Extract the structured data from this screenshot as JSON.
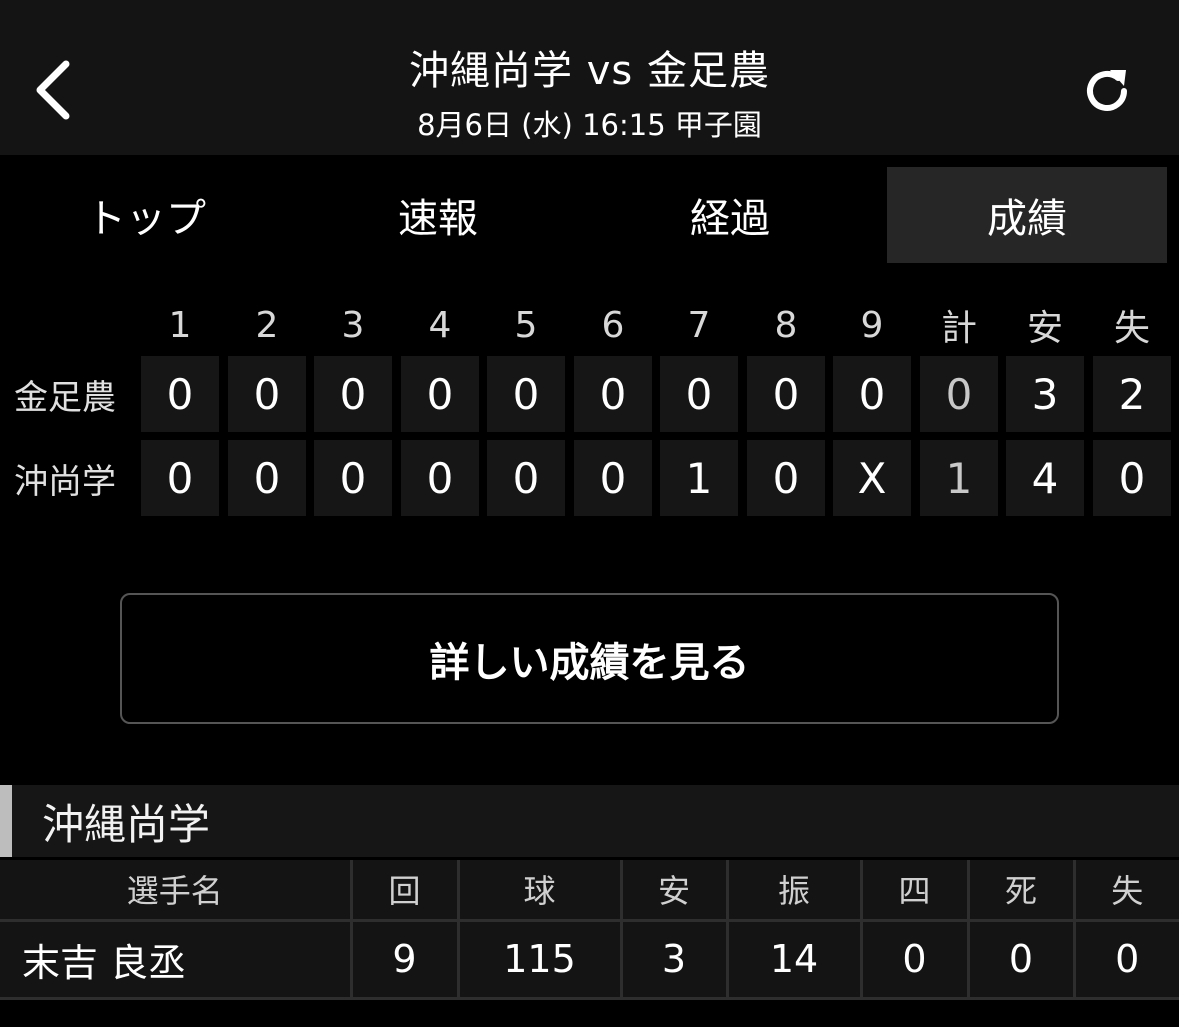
{
  "header": {
    "title": "沖縄尚学 vs 金足農",
    "subtitle": "8月6日 (水) 16:15 甲子園"
  },
  "tabs": [
    {
      "label": "トップ",
      "active": false
    },
    {
      "label": "速報",
      "active": false
    },
    {
      "label": "経過",
      "active": false
    },
    {
      "label": "成績",
      "active": true
    }
  ],
  "scoreboard": {
    "columns": [
      "1",
      "2",
      "3",
      "4",
      "5",
      "6",
      "7",
      "8",
      "9",
      "計",
      "安",
      "失"
    ],
    "teams": [
      {
        "name": "金足農",
        "scores": [
          "0",
          "0",
          "0",
          "0",
          "0",
          "0",
          "0",
          "0",
          "0",
          "0",
          "3",
          "2"
        ]
      },
      {
        "name": "沖尚学",
        "scores": [
          "0",
          "0",
          "0",
          "0",
          "0",
          "0",
          "1",
          "0",
          "X",
          "1",
          "4",
          "0"
        ]
      }
    ]
  },
  "detail_button": "詳しい成績を見る",
  "pitching": {
    "team": "沖縄尚学",
    "headers": [
      "選手名",
      "回",
      "球",
      "安",
      "振",
      "四",
      "死",
      "失"
    ],
    "rows": [
      [
        "末吉 良丞",
        "9",
        "115",
        "3",
        "14",
        "0",
        "0",
        "0"
      ]
    ]
  }
}
